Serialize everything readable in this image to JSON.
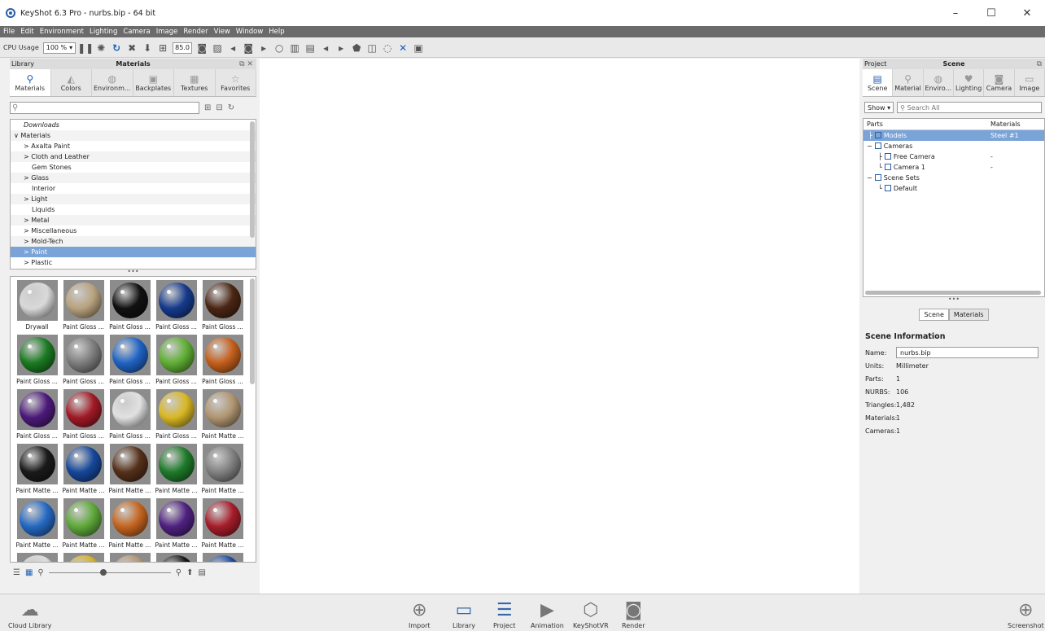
{
  "window": {
    "title": "KeyShot 6.3 Pro  - nurbs.bip  - 64 bit",
    "minimize": "–",
    "maximize": "☐",
    "close": "✕"
  },
  "menu": [
    "File",
    "Edit",
    "Environment",
    "Lighting",
    "Camera",
    "Image",
    "Render",
    "View",
    "Window",
    "Help"
  ],
  "toolbar": {
    "cpu_label": "CPU Usage",
    "cpu_value": "100 %",
    "fov_value": "85.0"
  },
  "library": {
    "panel_left": "Library",
    "panel_title": "Materials",
    "tabs": [
      {
        "label": "Materials",
        "icon": "⚲"
      },
      {
        "label": "Colors",
        "icon": "◭"
      },
      {
        "label": "Environm...",
        "icon": "◍"
      },
      {
        "label": "Backplates",
        "icon": "▣"
      },
      {
        "label": "Textures",
        "icon": "▦"
      },
      {
        "label": "Favorites",
        "icon": "☆"
      }
    ],
    "search_placeholder": "",
    "tree": [
      {
        "label": "Downloads",
        "prefix": ""
      },
      {
        "label": "Materials",
        "prefix": "∨"
      },
      {
        "label": "Axalta Paint",
        "prefix": ">"
      },
      {
        "label": "Cloth and Leather",
        "prefix": ">"
      },
      {
        "label": "Gem Stones",
        "prefix": ""
      },
      {
        "label": "Glass",
        "prefix": ">"
      },
      {
        "label": "Interior",
        "prefix": ""
      },
      {
        "label": "Light",
        "prefix": ">"
      },
      {
        "label": "Liquids",
        "prefix": ""
      },
      {
        "label": "Metal",
        "prefix": ">"
      },
      {
        "label": "Miscellaneous",
        "prefix": ">"
      },
      {
        "label": "Mold-Tech",
        "prefix": ">"
      },
      {
        "label": "Paint",
        "prefix": ">"
      },
      {
        "label": "Plastic",
        "prefix": ">"
      }
    ],
    "thumbnails": [
      {
        "label": "Drywall",
        "color": "#d9d9d9"
      },
      {
        "label": "Paint Gloss ...",
        "color": "#b8a27e"
      },
      {
        "label": "Paint Gloss ...",
        "color": "#111111"
      },
      {
        "label": "Paint Gloss ...",
        "color": "#163a8c"
      },
      {
        "label": "Paint Gloss ...",
        "color": "#4b2614"
      },
      {
        "label": "Paint Gloss ...",
        "color": "#1b7a22"
      },
      {
        "label": "Paint Gloss ...",
        "color": "#7d7d7d"
      },
      {
        "label": "Paint Gloss ...",
        "color": "#1f63c4"
      },
      {
        "label": "Paint Gloss ...",
        "color": "#5fae34"
      },
      {
        "label": "Paint Gloss ...",
        "color": "#c45f1c"
      },
      {
        "label": "Paint Gloss ...",
        "color": "#4c1a7a"
      },
      {
        "label": "Paint Gloss ...",
        "color": "#a01a26"
      },
      {
        "label": "Paint Gloss ...",
        "color": "#e1e1e1"
      },
      {
        "label": "Paint Gloss ...",
        "color": "#d8b724"
      },
      {
        "label": "Paint Matte ...",
        "color": "#b09572"
      },
      {
        "label": "Paint Matte ...",
        "color": "#1a1a1a"
      },
      {
        "label": "Paint Matte ...",
        "color": "#16479a"
      },
      {
        "label": "Paint Matte ...",
        "color": "#55301a"
      },
      {
        "label": "Paint Matte ...",
        "color": "#1e7a2a"
      },
      {
        "label": "Paint Matte ...",
        "color": "#818181"
      },
      {
        "label": "Paint Matte ...",
        "color": "#2468c2"
      },
      {
        "label": "Paint Matte ...",
        "color": "#5ea83a"
      },
      {
        "label": "Paint Matte ...",
        "color": "#c4641f"
      },
      {
        "label": "Paint Matte ...",
        "color": "#4e2180"
      },
      {
        "label": "Paint Matte ...",
        "color": "#a51d2a"
      },
      {
        "label": "",
        "color": "#dddddd"
      },
      {
        "label": "",
        "color": "#d5b12a"
      },
      {
        "label": "",
        "color": "#b39574"
      },
      {
        "label": "",
        "color": "#151515"
      },
      {
        "label": "",
        "color": "#1d4c9c"
      }
    ]
  },
  "project": {
    "panel_left": "Project",
    "panel_title": "Scene",
    "tabs": [
      {
        "label": "Scene",
        "icon": "▤"
      },
      {
        "label": "Material",
        "icon": "⚲"
      },
      {
        "label": "Enviro...",
        "icon": "◍"
      },
      {
        "label": "Lighting",
        "icon": "♥"
      },
      {
        "label": "Camera",
        "icon": "◙"
      },
      {
        "label": "Image",
        "icon": "▭"
      }
    ],
    "show_label": "Show ▾",
    "search_placeholder": "Search All",
    "columns": {
      "parts": "Parts",
      "materials": "Materials"
    },
    "rows": [
      {
        "part": "Models",
        "material": "Steel #1"
      },
      {
        "part": "Cameras",
        "material": ""
      },
      {
        "part": "Free Camera",
        "material": "-"
      },
      {
        "part": "Camera 1",
        "material": "-"
      },
      {
        "part": "Scene Sets",
        "material": ""
      },
      {
        "part": "Default",
        "material": ""
      }
    ],
    "subtabs": [
      "Scene",
      "Materials"
    ],
    "info": {
      "heading": "Scene Information",
      "name_label": "Name:",
      "name_value": "nurbs.bip",
      "units_label": "Units:",
      "units_value": "Millimeter",
      "parts_label": "Parts:",
      "parts_value": "1",
      "nurbs_label": "NURBS:",
      "nurbs_value": "106",
      "tri_label": "Triangles:",
      "tri_value": "1,482",
      "mat_label": "Materials:",
      "mat_value": "1",
      "cam_label": "Cameras:",
      "cam_value": "1"
    }
  },
  "dock": {
    "cloud": "Cloud Library",
    "items": [
      "Import",
      "Library",
      "Project",
      "Animation",
      "KeyShotVR",
      "Render"
    ],
    "screenshot": "Screenshot"
  }
}
